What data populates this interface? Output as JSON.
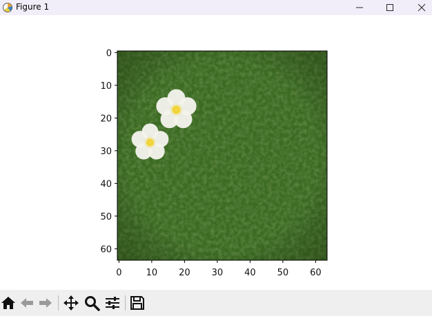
{
  "window": {
    "title": "Figure 1"
  },
  "chart_data": {
    "type": "image",
    "image_size": [
      64,
      64
    ],
    "x_ticks": [
      0,
      10,
      20,
      30,
      40,
      50,
      60
    ],
    "y_ticks": [
      0,
      10,
      20,
      30,
      40,
      50,
      60
    ],
    "xlim": [
      -0.5,
      63.5
    ],
    "ylim": [
      63.5,
      -0.5
    ],
    "content": "green grass with two white flowers with yellow centers",
    "flowers": [
      {
        "center": [
          17.5,
          17.5
        ],
        "radius": 6.5
      },
      {
        "center": [
          9.5,
          27.5
        ],
        "radius": 6
      }
    ],
    "colors": {
      "grass": "#3b6a22",
      "petal": "#f4f2ec",
      "center": "#f2d43c"
    }
  },
  "toolbar": {
    "buttons": [
      "home-icon",
      "back-icon",
      "forward-icon",
      "pan-icon",
      "zoom-icon",
      "configure-subplots-icon",
      "save-icon"
    ]
  }
}
